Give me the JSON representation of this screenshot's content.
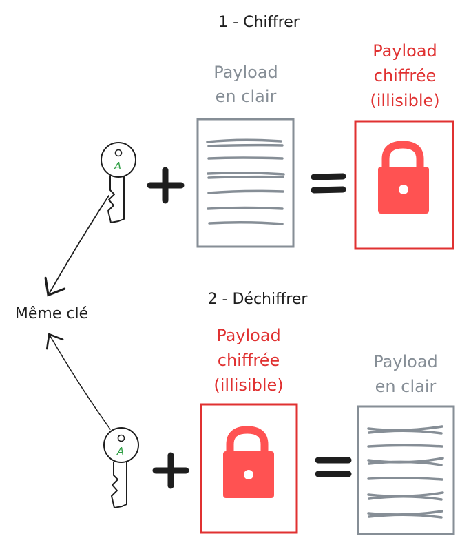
{
  "step1": {
    "title": "1 - Chiffrer",
    "plain_label": [
      "Payload",
      "en clair"
    ],
    "cipher_label": [
      "Payload",
      "chiffrée",
      "(illisible)"
    ],
    "key_letter": "A",
    "plus": "+",
    "equals": "="
  },
  "step2": {
    "title": "2 - Déchiffrer",
    "cipher_label": [
      "Payload",
      "chiffrée",
      "(illisible)"
    ],
    "plain_label": [
      "Payload",
      "en clair"
    ],
    "key_letter": "A",
    "plus": "+",
    "equals": "="
  },
  "shared_key_label": "Même clé",
  "colors": {
    "ink": "#1e1e1e",
    "grey": "#868e96",
    "red_stroke": "#e03131",
    "red_fill": "#ff5252",
    "green": "#2f9e44"
  }
}
